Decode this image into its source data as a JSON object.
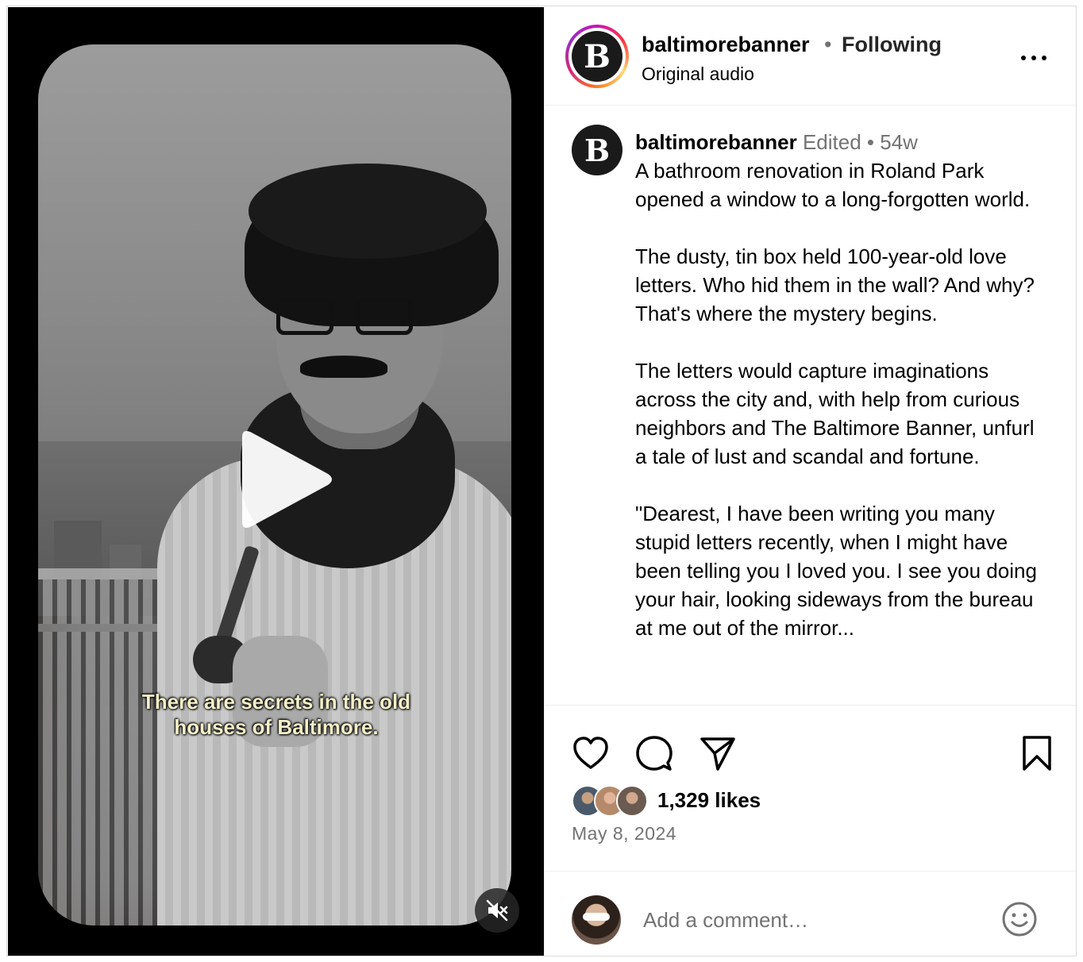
{
  "video": {
    "caption_line1": "There are secrets in the old",
    "caption_line2": "houses of Baltimore."
  },
  "header": {
    "username": "baltimorebanner",
    "separator": "•",
    "follow_status": "Following",
    "audio": "Original audio",
    "logo_letter": "B"
  },
  "post": {
    "username": "baltimorebanner",
    "edited": "Edited",
    "separator": "•",
    "age": "54w",
    "caption": "A bathroom renovation in Roland Park opened a window to a long-forgotten world.\n\nThe dusty, tin box held 100-year-old love letters. Who hid them in the wall? And why? That's where the mystery begins.\n\nThe letters would capture imaginations across the city and, with help from curious neighbors and The Baltimore Banner, unfurl a tale of lust and scandal and fortune.\n\n\"Dearest, I have been writing you many stupid letters recently, when I might have been telling you I loved you. I see you doing your hair, looking sideways from the bureau at me out of the mirror..."
  },
  "stats": {
    "likes": "1,329 likes",
    "date": "May 8, 2024"
  },
  "comment_box": {
    "placeholder": "Add a comment…"
  },
  "icons": [
    "play-icon",
    "muted-speaker-icon",
    "more-options-icon",
    "heart-icon",
    "comment-icon",
    "share-icon",
    "bookmark-icon",
    "emoji-icon"
  ],
  "colors": {
    "muted_text": "#737373",
    "border": "#dbdbdb",
    "caption_yellow": "#f4efc8"
  }
}
